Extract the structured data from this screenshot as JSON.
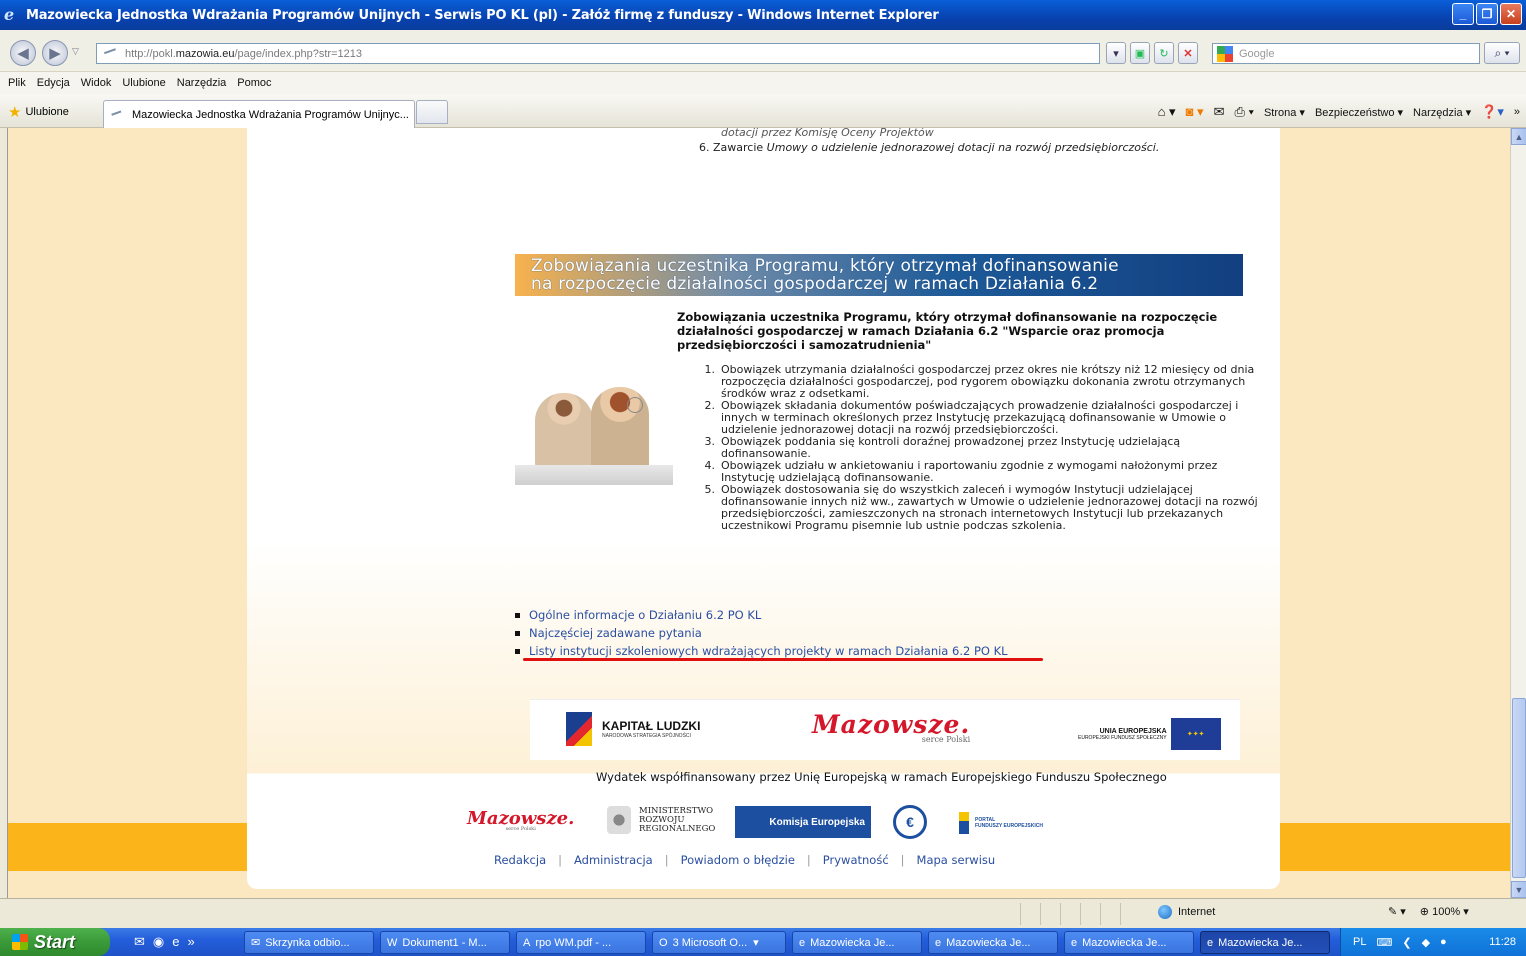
{
  "window": {
    "title": "Mazowiecka Jednostka Wdrażania Programów Unijnych - Serwis PO KL (pl) - Załóż firmę z funduszy - Windows Internet Explorer",
    "buttons": [
      "_",
      "❐",
      "✕"
    ]
  },
  "address": {
    "prefix": "http://pokl.",
    "host": "mazowia.eu",
    "path": "/page/index.php?str=1213",
    "search_placeholder": "Google"
  },
  "menu": [
    "Plik",
    "Edycja",
    "Widok",
    "Ulubione",
    "Narzędzia",
    "Pomoc"
  ],
  "favbar": {
    "favorites_label": "Ulubione",
    "tab_title": "Mazowiecka Jednostka Wdrażania Programów Unijnyc...",
    "commands": [
      "Strona ▾",
      "Bezpieczeństwo ▾",
      "Narzędzia ▾"
    ]
  },
  "page": {
    "partial_step5": "dotacji przez Komisję Oceny Projektów",
    "step6_num": "6.",
    "step6_prefix": "Zawarcie ",
    "step6_italic": "Umowy o udzielenie jednorazowej dotacji na rozwój przedsiębiorczości.",
    "banner_line1": "Zobowiązania uczestnika Programu, który otrzymał dofinansowanie",
    "banner_line2": "na rozpoczęcie działalności gospodarczej w ramach Działania 6.2",
    "heading": "Zobowiązania uczestnika Programu, który otrzymał dofinansowanie na rozpoczęcie działalności gospodarczej w ramach Działania 6.2 \"Wsparcie oraz promocja przedsiębiorczości i samozatrudnienia\"",
    "obligations": [
      {
        "num": "1.",
        "text": "Obowiązek utrzymania działalności gospodarczej przez okres nie krótszy niż 12 miesięcy od dnia rozpoczęcia działalności gospodarczej, pod rygorem obowiązku dokonania zwrotu otrzymanych środków wraz z odsetkami."
      },
      {
        "num": "2.",
        "text": "Obowiązek składania dokumentów poświadczających prowadzenie działalności gospodarczej i innych w terminach określonych przez Instytucję przekazującą dofinansowanie w Umowie o udzielenie jednorazowej dotacji na rozwój przedsiębiorczości."
      },
      {
        "num": "3.",
        "text": "Obowiązek poddania się kontroli doraźnej prowadzonej przez Instytucję udzielającą dofinansowanie."
      },
      {
        "num": "4.",
        "text": "Obowiązek udziału w ankietowaniu i raportowaniu zgodnie z wymogami nałożonymi przez Instytucję udzielającą dofinansowanie."
      },
      {
        "num": "5.",
        "text": "Obowiązek dostosowania się do wszystkich zaleceń i wymogów Instytucji udzielającej dofinansowanie innych niż ww., zawartych w Umowie o udzielenie jednorazowej dotacji na rozwój przedsiębiorczości, zamieszczonych na stronach internetowych Instytucji lub przekazanych uczestnikowi Programu pisemnie lub ustnie podczas szkolenia."
      }
    ],
    "links": [
      "Ogólne informacje o Działaniu 6.2 PO KL",
      "Najczęściej zadawane pytania",
      "Listy instytucji szkoleniowych wdrażających projekty w ramach Działania 6.2 PO KL"
    ],
    "logos": {
      "kl_title": "KAPITAŁ LUDZKI",
      "kl_sub": "NARODOWA STRATEGIA SPÓJNOŚCI",
      "mazowsze": "Mazowsze.",
      "mazowsze_sub": "serce Polski",
      "ue_title": "UNIA EUROPEJSKA",
      "ue_sub": "EUROPEJSKI FUNDUSZ SPOŁECZNY"
    },
    "wydatek": "Wydatek współfinansowany przez Unię Europejską w ramach Europejskiego Funduszu Społecznego",
    "partners": {
      "mazowsze": "Mazowsze.",
      "mazowsze_sub": "serce Polski",
      "mrr": [
        "MINISTERSTWO",
        "ROZWOJU",
        "REGIONALNEGO"
      ],
      "ke": "Komisja Europejska",
      "euro": "€",
      "portal": [
        "PORTAL",
        "FUNDUSZY EUROPEJSKICH"
      ]
    },
    "footer_links": [
      "Redakcja",
      "Administracja",
      "Powiadom o błędzie",
      "Prywatność",
      "Mapa serwisu"
    ]
  },
  "status": {
    "zone": "Internet",
    "zoom": "100%"
  },
  "taskbar": {
    "start": "Start",
    "tasks": [
      {
        "label": "Skrzynka odbio...",
        "icon": "✉"
      },
      {
        "label": "Dokument1 - M...",
        "icon": "W"
      },
      {
        "label": "rpo WM.pdf - ...",
        "icon": "A"
      },
      {
        "label": "3 Microsoft O...",
        "icon": "O"
      },
      {
        "label": "Mazowiecka Je...",
        "icon": "e"
      },
      {
        "label": "Mazowiecka Je...",
        "icon": "e"
      },
      {
        "label": "Mazowiecka Je...",
        "icon": "e"
      },
      {
        "label": "Mazowiecka Je...",
        "icon": "e"
      }
    ],
    "lang": "PL",
    "clock": "11:28"
  }
}
